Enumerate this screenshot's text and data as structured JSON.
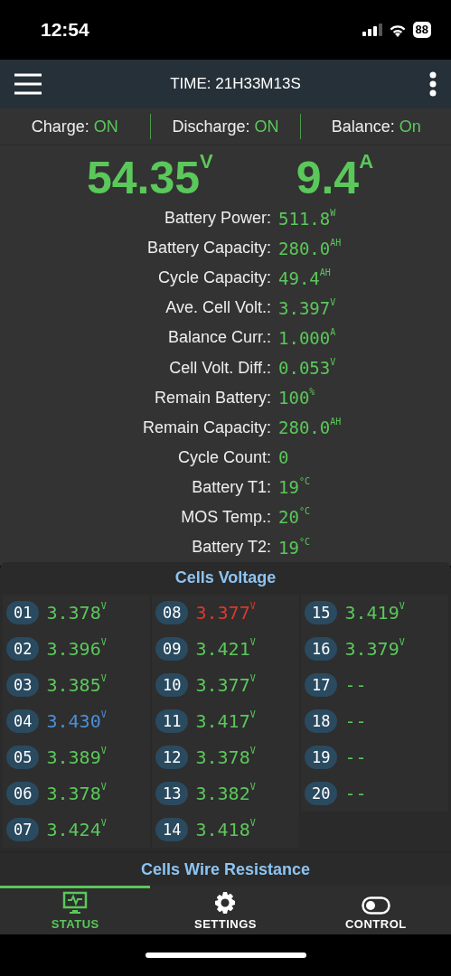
{
  "status_bar": {
    "time": "12:54",
    "battery": "88"
  },
  "app_bar": {
    "title": "TIME: 21H33M13S"
  },
  "switches": [
    {
      "label": "Charge:",
      "value": "ON"
    },
    {
      "label": "Discharge:",
      "value": "ON"
    },
    {
      "label": "Balance:",
      "value": "On"
    }
  ],
  "headline": [
    {
      "value": "54.35",
      "unit": "V"
    },
    {
      "value": "9.4",
      "unit": "A"
    }
  ],
  "stats": [
    {
      "label": "Battery Power:",
      "value": "511.8",
      "unit": "W"
    },
    {
      "label": "Battery Capacity:",
      "value": "280.0",
      "unit": "AH"
    },
    {
      "label": "Cycle Capacity:",
      "value": "49.4",
      "unit": "AH"
    },
    {
      "label": "Ave. Cell Volt.:",
      "value": "3.397",
      "unit": "V"
    },
    {
      "label": "Balance Curr.:",
      "value": "1.000",
      "unit": "A"
    },
    {
      "label": "Cell Volt. Diff.:",
      "value": "0.053",
      "unit": "V"
    },
    {
      "label": "Remain Battery:",
      "value": "100",
      "unit": "%"
    },
    {
      "label": "Remain Capacity:",
      "value": "280.0",
      "unit": "AH"
    },
    {
      "label": "Cycle Count:",
      "value": "0"
    },
    {
      "label": "Battery T1:",
      "value": "19",
      "unit": "°C"
    },
    {
      "label": "MOS Temp.:",
      "value": "20",
      "unit": "°C"
    },
    {
      "label": "Battery T2:",
      "value": "19",
      "unit": "°C"
    }
  ],
  "cells_voltage": {
    "title": "Cells Voltage",
    "cells": [
      {
        "index": "01",
        "value": "3.378",
        "unit": "V",
        "color": "#5ac85a"
      },
      {
        "index": "02",
        "value": "3.396",
        "unit": "V",
        "color": "#5ac85a"
      },
      {
        "index": "03",
        "value": "3.385",
        "unit": "V",
        "color": "#5ac85a"
      },
      {
        "index": "04",
        "value": "3.430",
        "unit": "V",
        "color": "#4a90d9"
      },
      {
        "index": "05",
        "value": "3.389",
        "unit": "V",
        "color": "#5ac85a"
      },
      {
        "index": "06",
        "value": "3.378",
        "unit": "V",
        "color": "#5ac85a"
      },
      {
        "index": "07",
        "value": "3.424",
        "unit": "V",
        "color": "#5ac85a"
      },
      {
        "index": "08",
        "value": "3.377",
        "unit": "V",
        "color": "#d93a2e"
      },
      {
        "index": "09",
        "value": "3.421",
        "unit": "V",
        "color": "#5ac85a"
      },
      {
        "index": "10",
        "value": "3.377",
        "unit": "V",
        "color": "#5ac85a"
      },
      {
        "index": "11",
        "value": "3.417",
        "unit": "V",
        "color": "#5ac85a"
      },
      {
        "index": "12",
        "value": "3.378",
        "unit": "V",
        "color": "#5ac85a"
      },
      {
        "index": "13",
        "value": "3.382",
        "unit": "V",
        "color": "#5ac85a"
      },
      {
        "index": "14",
        "value": "3.418",
        "unit": "V",
        "color": "#5ac85a"
      },
      {
        "index": "15",
        "value": "3.419",
        "unit": "V",
        "color": "#5ac85a"
      },
      {
        "index": "16",
        "value": "3.379",
        "unit": "V",
        "color": "#5ac85a"
      },
      {
        "index": "17",
        "value": "--",
        "color": "#5ac85a"
      },
      {
        "index": "18",
        "value": "--",
        "color": "#5ac85a"
      },
      {
        "index": "19",
        "value": "--",
        "color": "#5ac85a"
      },
      {
        "index": "20",
        "value": "--",
        "color": "#5ac85a"
      }
    ]
  },
  "wire_resistance": {
    "title": "Cells Wire Resistance"
  },
  "tabs": [
    {
      "label": "STATUS",
      "kind": "monitor",
      "selected": true
    },
    {
      "label": "SETTINGS",
      "kind": "gear",
      "selected": false
    },
    {
      "label": "CONTROL",
      "kind": "toggle",
      "selected": false
    }
  ]
}
